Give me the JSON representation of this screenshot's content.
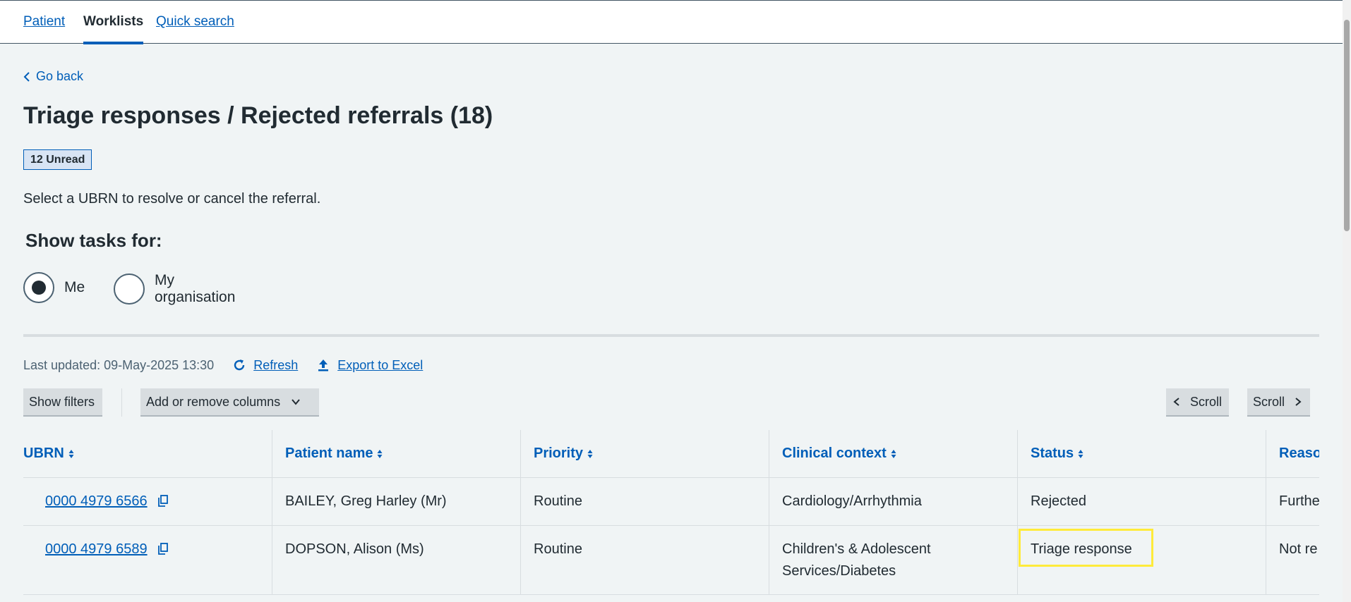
{
  "nav": {
    "tabs": [
      {
        "label": "Patient"
      },
      {
        "label": "Worklists"
      },
      {
        "label": "Quick search"
      }
    ],
    "active": "Worklists"
  },
  "header": {
    "go_back": "Go back",
    "title": "Triage responses / Rejected referrals (18)",
    "unread_badge": "12 Unread",
    "instruction": "Select a UBRN to resolve or cancel the referral."
  },
  "filter": {
    "legend": "Show tasks for:",
    "options": [
      {
        "label": "Me",
        "checked": true
      },
      {
        "label": "My organisation",
        "checked": false
      }
    ]
  },
  "toolbar": {
    "last_updated": "Last updated: 09-May-2025 13:30",
    "refresh": "Refresh",
    "export": "Export to Excel",
    "show_filters": "Show filters",
    "columns": "Add or remove columns",
    "scroll_left": "Scroll",
    "scroll_right": "Scroll"
  },
  "table": {
    "headers": [
      "UBRN",
      "Patient name",
      "Priority",
      "Clinical context",
      "Status",
      "Reaso"
    ],
    "rows": [
      {
        "ubrn": "0000 4979 6566",
        "patient": "BAILEY, Greg Harley (Mr)",
        "priority": "Routine",
        "context": "Cardiology/Arrhythmia",
        "status": "Rejected",
        "reason": "Furthe"
      },
      {
        "ubrn": "0000 4979 6589",
        "patient": "DOPSON, Alison (Ms)",
        "priority": "Routine",
        "context": "Children's & Adolescent Services/Diabetes",
        "status": "Triage response",
        "reason": "Not re"
      }
    ]
  },
  "colors": {
    "link": "#005eb8",
    "text": "#212b32",
    "background": "#f0f4f5",
    "badge_bg": "#d8e4f4",
    "highlight": "#ffeb3b"
  }
}
